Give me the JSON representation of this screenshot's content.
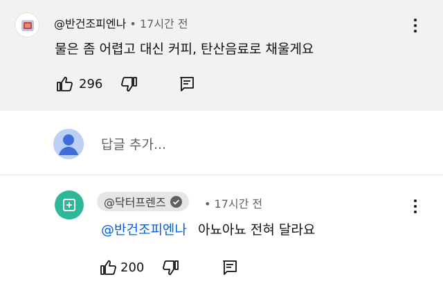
{
  "comment": {
    "author": "@반건조피엔나",
    "time": "17시간 전",
    "text": "물은 좀 어렵고 대신 커피, 탄산음료로 채울게요",
    "likes": "296"
  },
  "reply_box": {
    "placeholder": "답글 추가..."
  },
  "reply": {
    "author": "@닥터프렌즈",
    "time": "17시간 전",
    "mention": "@반건조피엔나",
    "text": "아뇨아뇨 전혀 달라요",
    "likes": "200"
  },
  "colors": {
    "mention": "#065fd4",
    "channel_avatar": "#2fb79a",
    "user_avatar_bg": "#bcd0f5",
    "highlight_bg": "#f2f2f2"
  },
  "icons": [
    "like-icon",
    "dislike-icon",
    "reply-icon",
    "more-vert-icon",
    "verified-icon",
    "user-avatar-icon"
  ]
}
